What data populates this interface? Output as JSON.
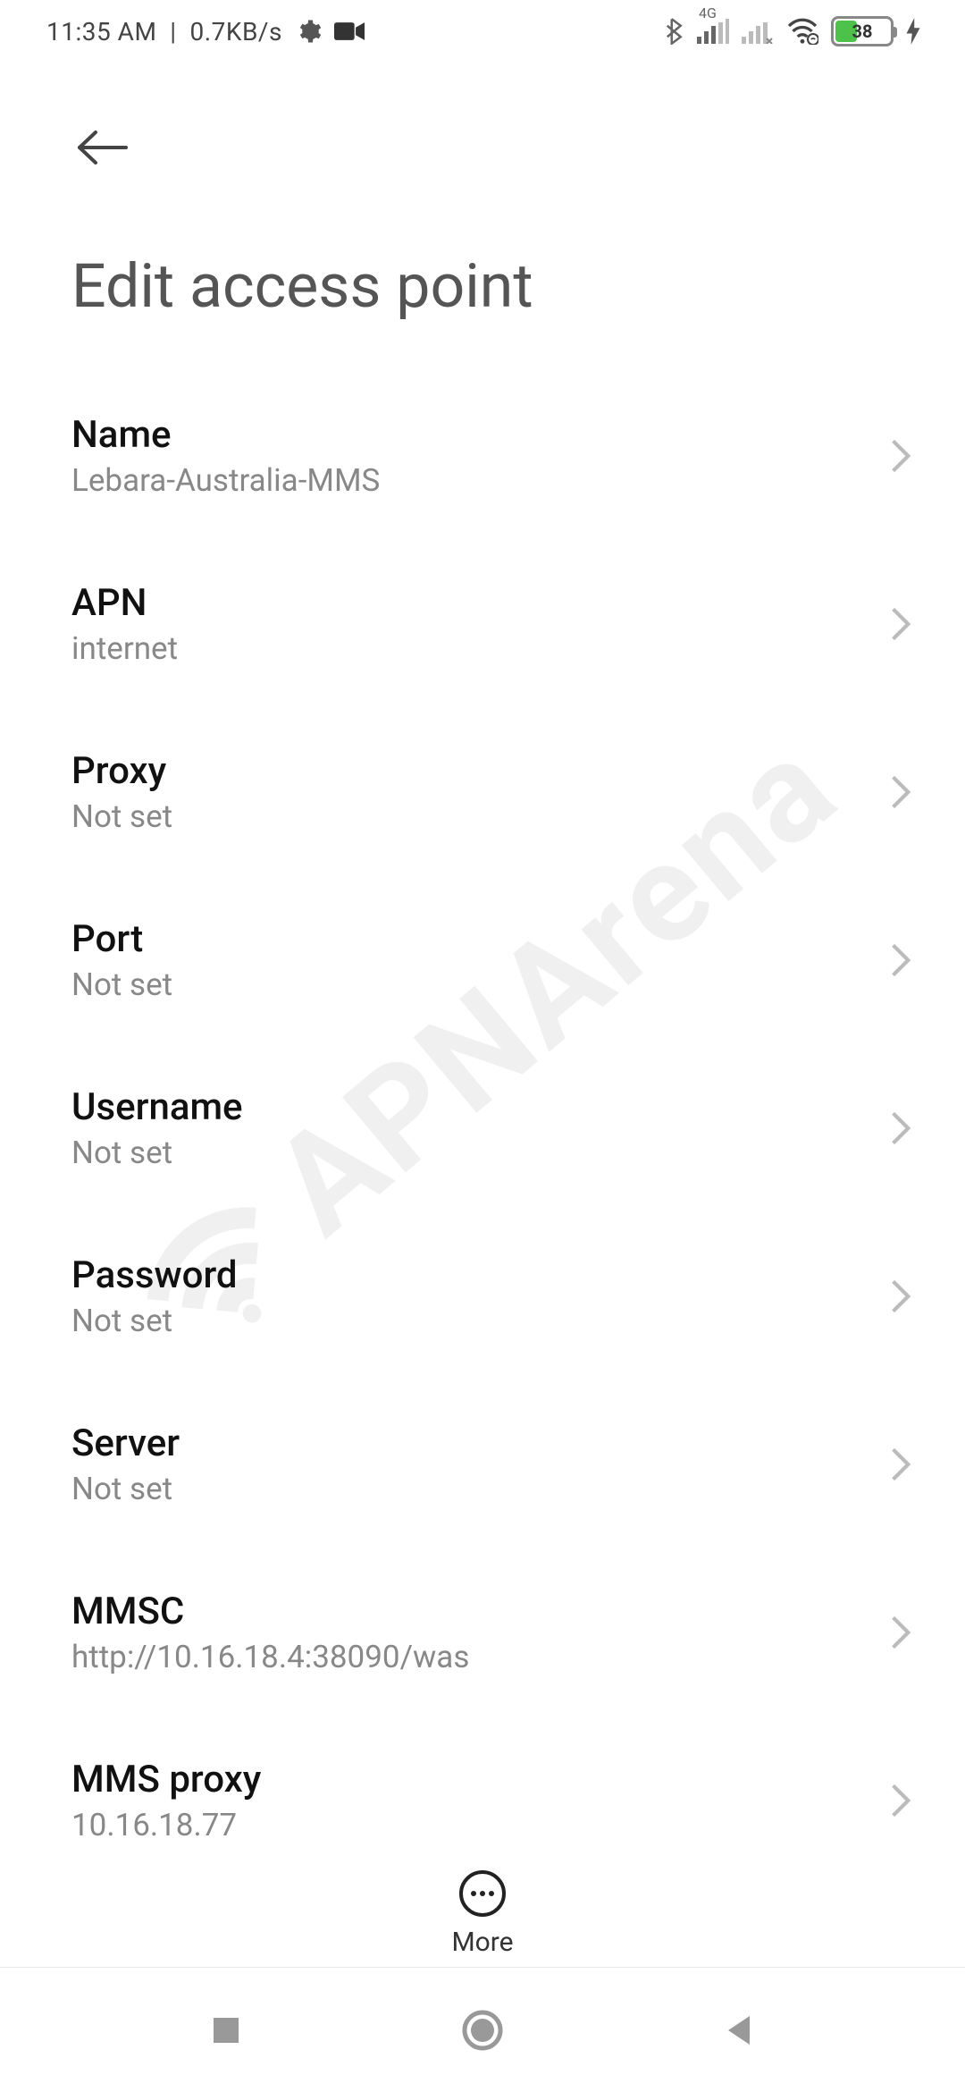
{
  "status": {
    "time": "11:35 AM",
    "speed": "0.7KB/s",
    "net_badge": "4G",
    "battery_percent": "38"
  },
  "header": {
    "title": "Edit access point"
  },
  "settings": [
    {
      "label": "Name",
      "value": "Lebara-Australia-MMS"
    },
    {
      "label": "APN",
      "value": "internet"
    },
    {
      "label": "Proxy",
      "value": "Not set"
    },
    {
      "label": "Port",
      "value": "Not set"
    },
    {
      "label": "Username",
      "value": "Not set"
    },
    {
      "label": "Password",
      "value": "Not set"
    },
    {
      "label": "Server",
      "value": "Not set"
    },
    {
      "label": "MMSC",
      "value": "http://10.16.18.4:38090/was"
    },
    {
      "label": "MMS proxy",
      "value": "10.16.18.77"
    }
  ],
  "more": {
    "label": "More"
  },
  "watermark": {
    "text": "APNArena"
  }
}
